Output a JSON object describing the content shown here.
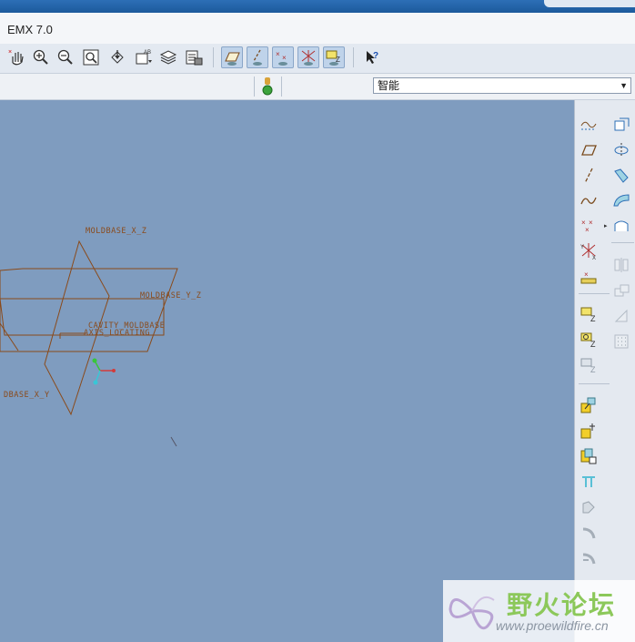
{
  "window": {
    "title": "EMX 7.0"
  },
  "selection_filter": {
    "value": "智能"
  },
  "datums": {
    "plane_xz": "MOLDBASE_X_Z",
    "plane_yz": "MOLDBASE_Y_Z",
    "plane_xy": "DBASE_X_Y",
    "csys_cavity": "CAVITY_MOLDBASE",
    "csys_axis": "AXIS_LOCATING"
  },
  "watermark": {
    "name": "野火论坛",
    "url": "www.proewildfire.cn"
  },
  "colors": {
    "canvas": "#7f9cbf",
    "datum": "#8a4a1a",
    "accent": "#2d6fb6"
  }
}
